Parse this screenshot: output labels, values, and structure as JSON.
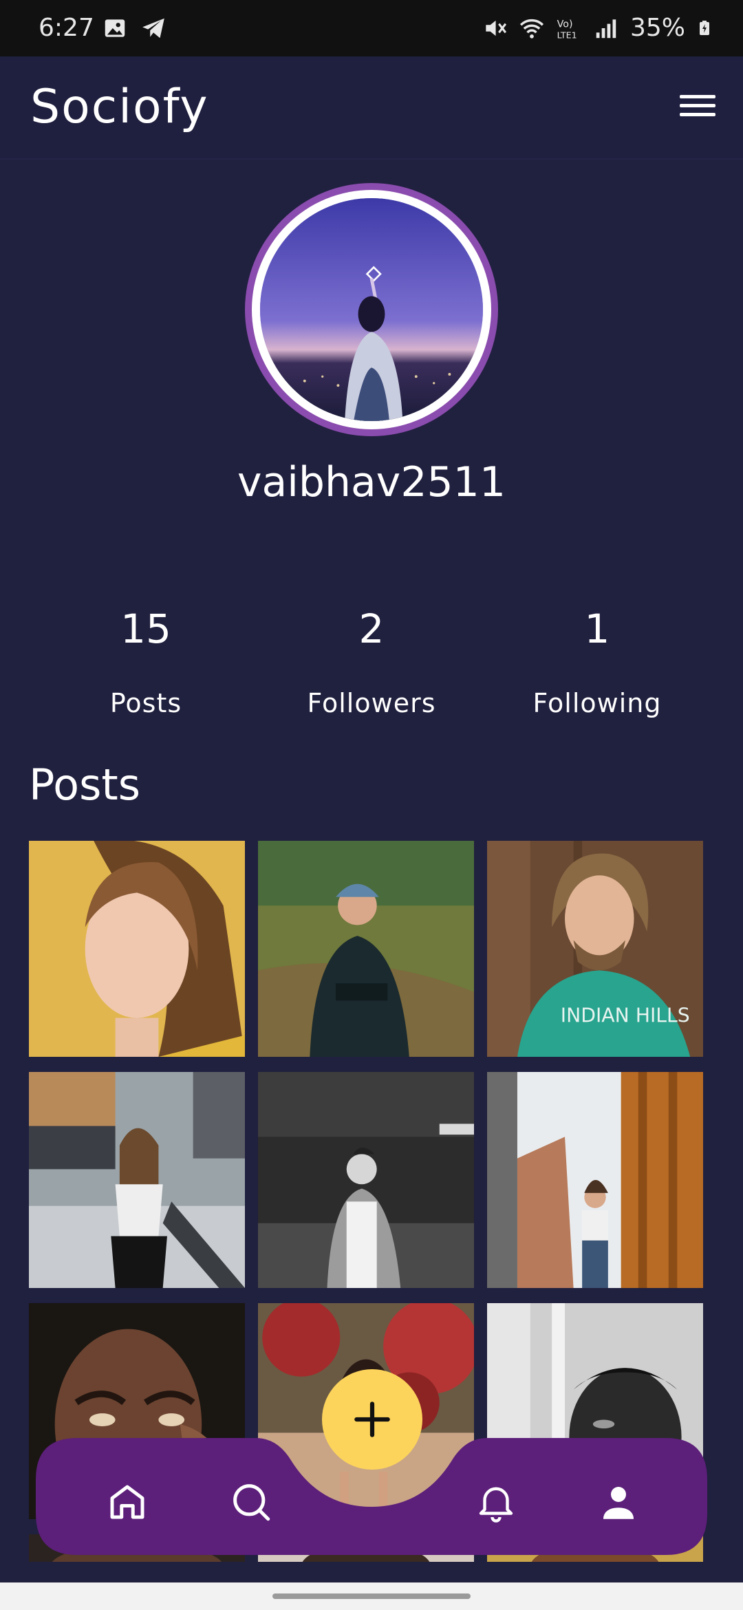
{
  "status_bar": {
    "time": "6:27",
    "battery": "35%",
    "icons": [
      "image-icon",
      "telegram-icon",
      "mute-icon",
      "wifi-icon",
      "volte-icon",
      "signal-icon",
      "battery-charging-icon"
    ]
  },
  "app": {
    "logo": "Sociofy",
    "menu_icon": "hamburger-menu-icon"
  },
  "profile": {
    "username": "vaibhav2511",
    "stats": [
      {
        "value": "15",
        "label": "Posts"
      },
      {
        "value": "2",
        "label": "Followers"
      },
      {
        "value": "1",
        "label": "Following"
      }
    ]
  },
  "posts": {
    "heading": "Posts"
  },
  "bottom_nav": {
    "items": [
      "home-icon",
      "search-icon",
      "add-icon",
      "bell-icon",
      "profile-icon"
    ],
    "accent": "#5c1f7a",
    "fab_color": "#fdd45b"
  }
}
